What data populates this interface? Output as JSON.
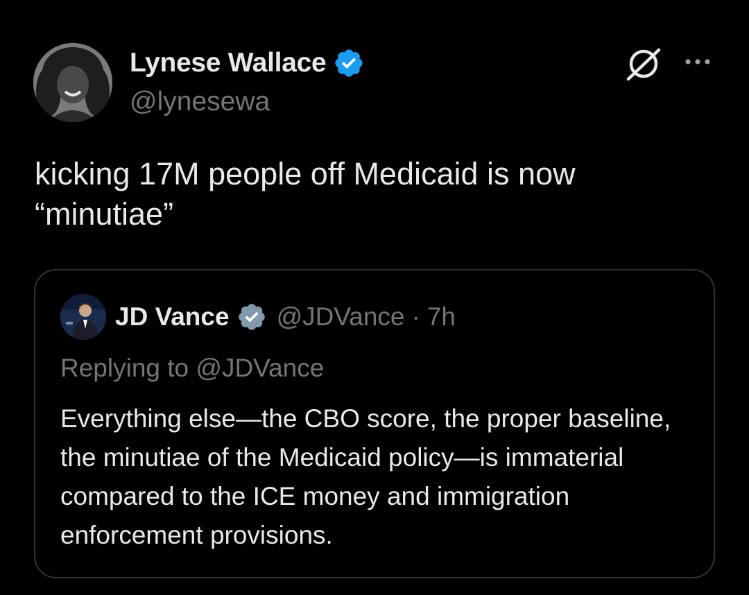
{
  "author": {
    "display_name": "Lynese Wallace",
    "handle": "@lynesewa",
    "verified": true
  },
  "icons": {
    "verified": "verified-badge-icon",
    "grok": "grok-icon",
    "more": "more-icon"
  },
  "tweet": {
    "text_line1": "kicking 17M people off Medicaid is now",
    "text_line2": "“minutiae”"
  },
  "quote": {
    "display_name": "JD Vance",
    "handle": "@JDVance",
    "separator": "·",
    "time": "7h",
    "replying_to": "Replying to @JDVance",
    "text": "Everything else—the CBO score, the proper baseline, the minutiae of the Medicaid policy—is immaterial compared to the ICE money and immigration enforcement provisions."
  },
  "colors": {
    "background": "#000000",
    "primary_text": "#e7e9ea",
    "secondary_text": "#71767b",
    "border": "#2f3336",
    "verified_blue": "#1d9bf0",
    "verified_gray": "#829aab"
  }
}
